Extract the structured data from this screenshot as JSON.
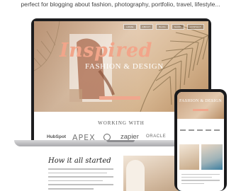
{
  "caption": "perfect for blogging about fashion, photography, portfolio, travel, lifestyle...",
  "site": {
    "nav": [
      "HOME",
      "ABOUT",
      "BLOG",
      "SHOP",
      "CONTACT"
    ],
    "hero_title": "Inspired",
    "hero_subtitle": "FASHION & DESIGN",
    "working_with": "WORKING WITH",
    "logos": {
      "hubspot": "HubSpot",
      "apex": "APEX",
      "zapier": "zapier",
      "oracle": "ORACLE"
    },
    "section_title": "How it all started"
  },
  "phone": {
    "hero_title": "FASHION & DESIGN"
  },
  "colors": {
    "accent": "#f0a78d",
    "device": "#1d1d1f"
  }
}
